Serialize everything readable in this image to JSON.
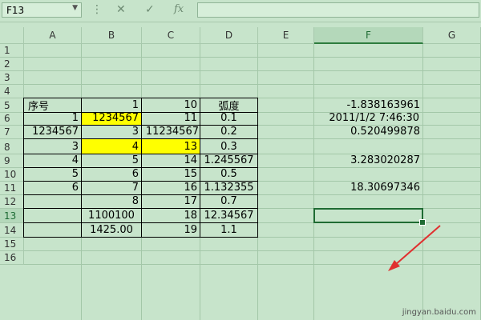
{
  "formula_bar": {
    "name_box": "F13",
    "name_dropdown_icon": "▼",
    "more_icon": "⋮",
    "cancel_icon": "✕",
    "confirm_icon": "✓",
    "function_icon": "fx",
    "formula": ""
  },
  "columns": [
    "A",
    "B",
    "C",
    "D",
    "E",
    "F",
    "G"
  ],
  "rows": [
    "1",
    "2",
    "3",
    "4",
    "5",
    "6",
    "7",
    "8",
    "9",
    "10",
    "11",
    "12",
    "13",
    "14",
    "15",
    "16"
  ],
  "active_cell": {
    "column": "F",
    "row": "13"
  },
  "cells": {
    "A5": "序号",
    "B5": "1",
    "C5": "10",
    "D5": "弧度",
    "F5": "-1.838163961",
    "A6": "1",
    "B6": "1234567",
    "C6": "11",
    "D6": "0.1",
    "F6": "2011/1/2 7:46:30",
    "A7": "1234567",
    "B7": "3",
    "C7": "11234567",
    "D7": "0.2",
    "F7": "0.520499878",
    "A8": "3",
    "B8": "4",
    "C8": "13",
    "D8": "0.3",
    "A9": "4",
    "B9": "5",
    "C9": "14",
    "D9": "1.245567",
    "F9": "3.283020287",
    "A10": "5",
    "B10": "6",
    "C10": "15",
    "D10": "0.5",
    "A11": "6",
    "B11": "7",
    "C11": "16",
    "D11": "1.132355",
    "F11": "18.30697346",
    "B12": "8",
    "C12": "17",
    "D12": "0.7",
    "B13": "1100100",
    "C13": "18",
    "D13": "12.34567",
    "B14": "1425.00",
    "C14": "19",
    "D14": "1.1"
  },
  "highlight_color": "#ffff00",
  "highlighted_cells": [
    "B6",
    "B8",
    "C8"
  ],
  "annotation": {
    "color": "#e03030",
    "icon": "arrow-icon"
  },
  "watermark": "jingyan.baidu.com"
}
